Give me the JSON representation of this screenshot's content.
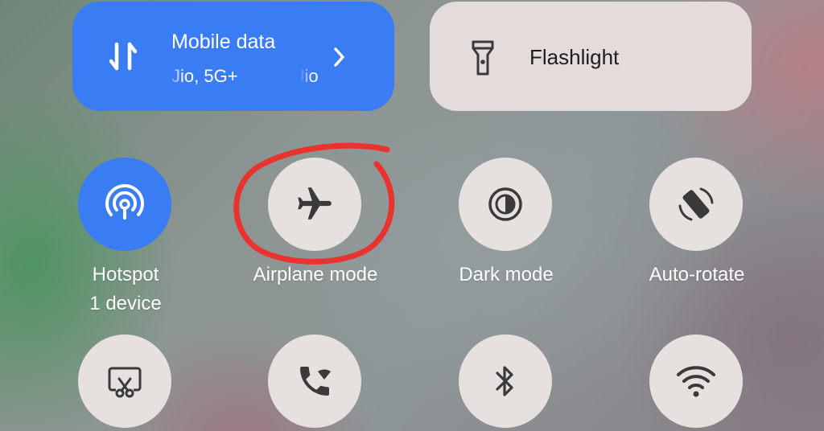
{
  "tiles": {
    "mobile_data": {
      "title": "Mobile data",
      "sub_left": "Jio, 5G+",
      "sub_right": "Jio"
    },
    "flashlight": {
      "title": "Flashlight"
    }
  },
  "toggles": [
    {
      "label": "Hotspot",
      "sub": "1 device",
      "icon": "hotspot-icon",
      "active": true
    },
    {
      "label": "Airplane mode",
      "icon": "airplane-icon",
      "active": false
    },
    {
      "label": "Dark mode",
      "icon": "dark-mode-icon",
      "active": false
    },
    {
      "label": "Auto-rotate",
      "icon": "auto-rotate-icon",
      "active": false
    }
  ],
  "bottom_toggles": [
    {
      "icon": "screenshot-icon"
    },
    {
      "icon": "wifi-calling-icon"
    },
    {
      "icon": "bluetooth-icon"
    },
    {
      "icon": "wifi-icon"
    }
  ],
  "colors": {
    "accent": "#3a7cf4",
    "tile_light": "#e3dcda",
    "circle_off": "#e6e1df",
    "icon_dark": "#3a3a3a",
    "annotation": "#e8332f"
  }
}
